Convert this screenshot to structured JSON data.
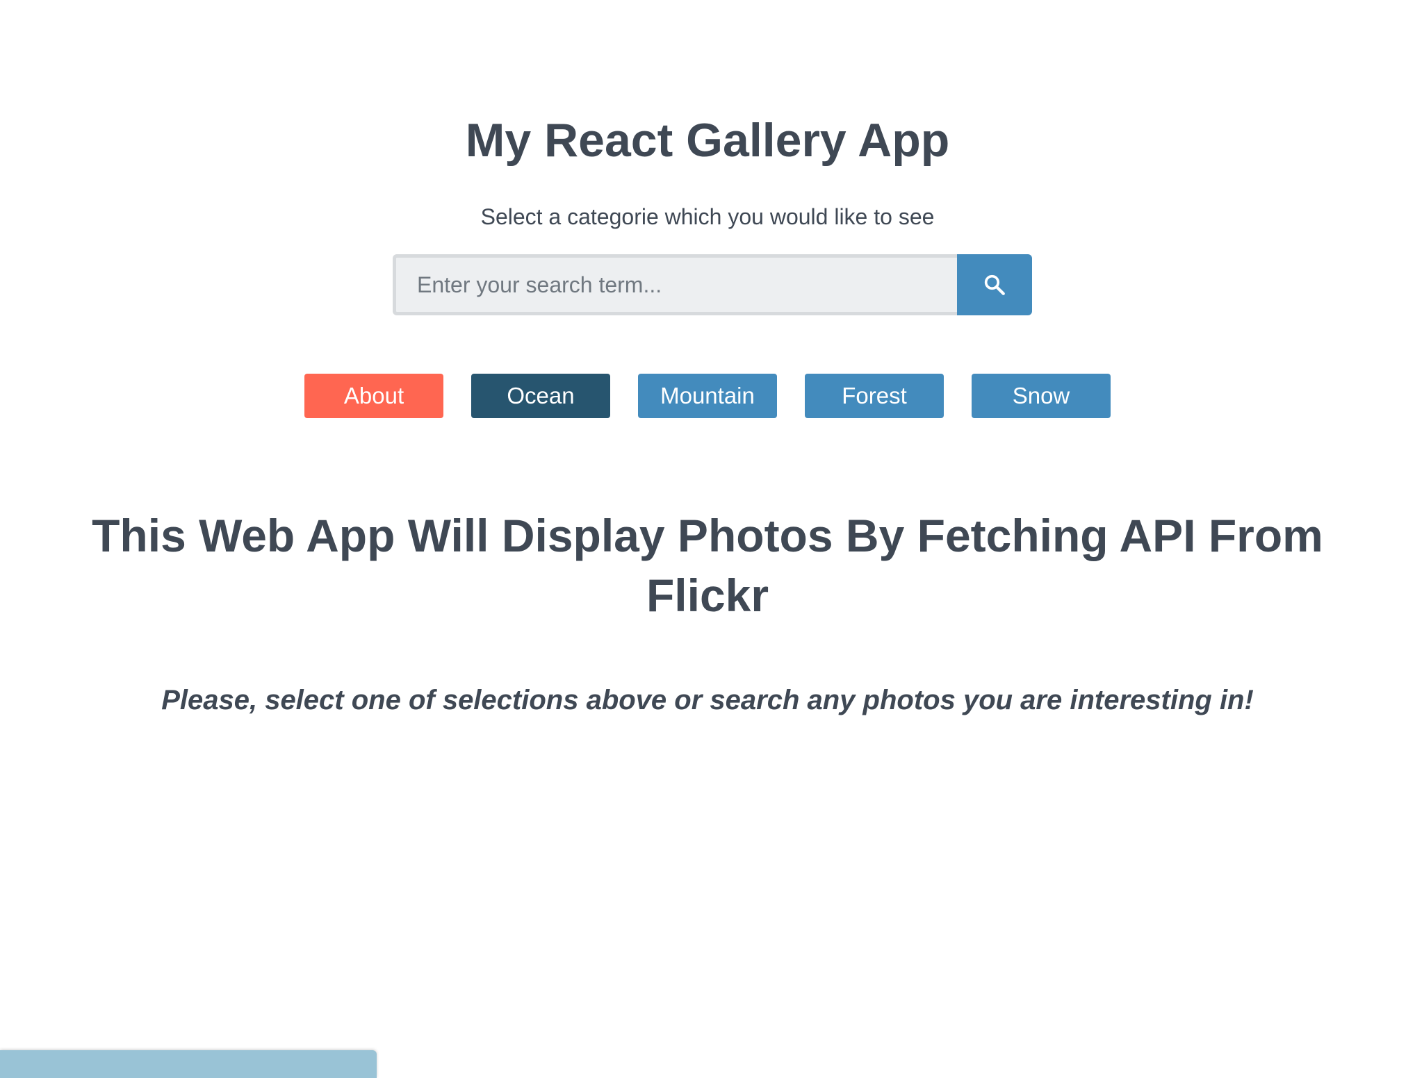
{
  "header": {
    "title": "My React Gallery App",
    "subtitle": "Select a categorie which you would like to see"
  },
  "search": {
    "placeholder": "Enter your search term...",
    "value": "",
    "button_icon": "search-icon"
  },
  "nav": {
    "items": [
      {
        "label": "About",
        "color": "#ff6651"
      },
      {
        "label": "Ocean",
        "color": "#27556f"
      },
      {
        "label": "Mountain",
        "color": "#438bbd"
      },
      {
        "label": "Forest",
        "color": "#438bbd"
      },
      {
        "label": "Snow",
        "color": "#438bbd"
      }
    ]
  },
  "main": {
    "heading": "This Web App Will Display Photos By Fetching API From Flickr",
    "instruction": "Please, select one of selections above or search any photos you are interesting in!"
  },
  "colors": {
    "text": "#3f4854",
    "accent": "#438bbd",
    "active": "#27556f",
    "about": "#ff6651",
    "bottom_bar": "#99c3d6"
  }
}
